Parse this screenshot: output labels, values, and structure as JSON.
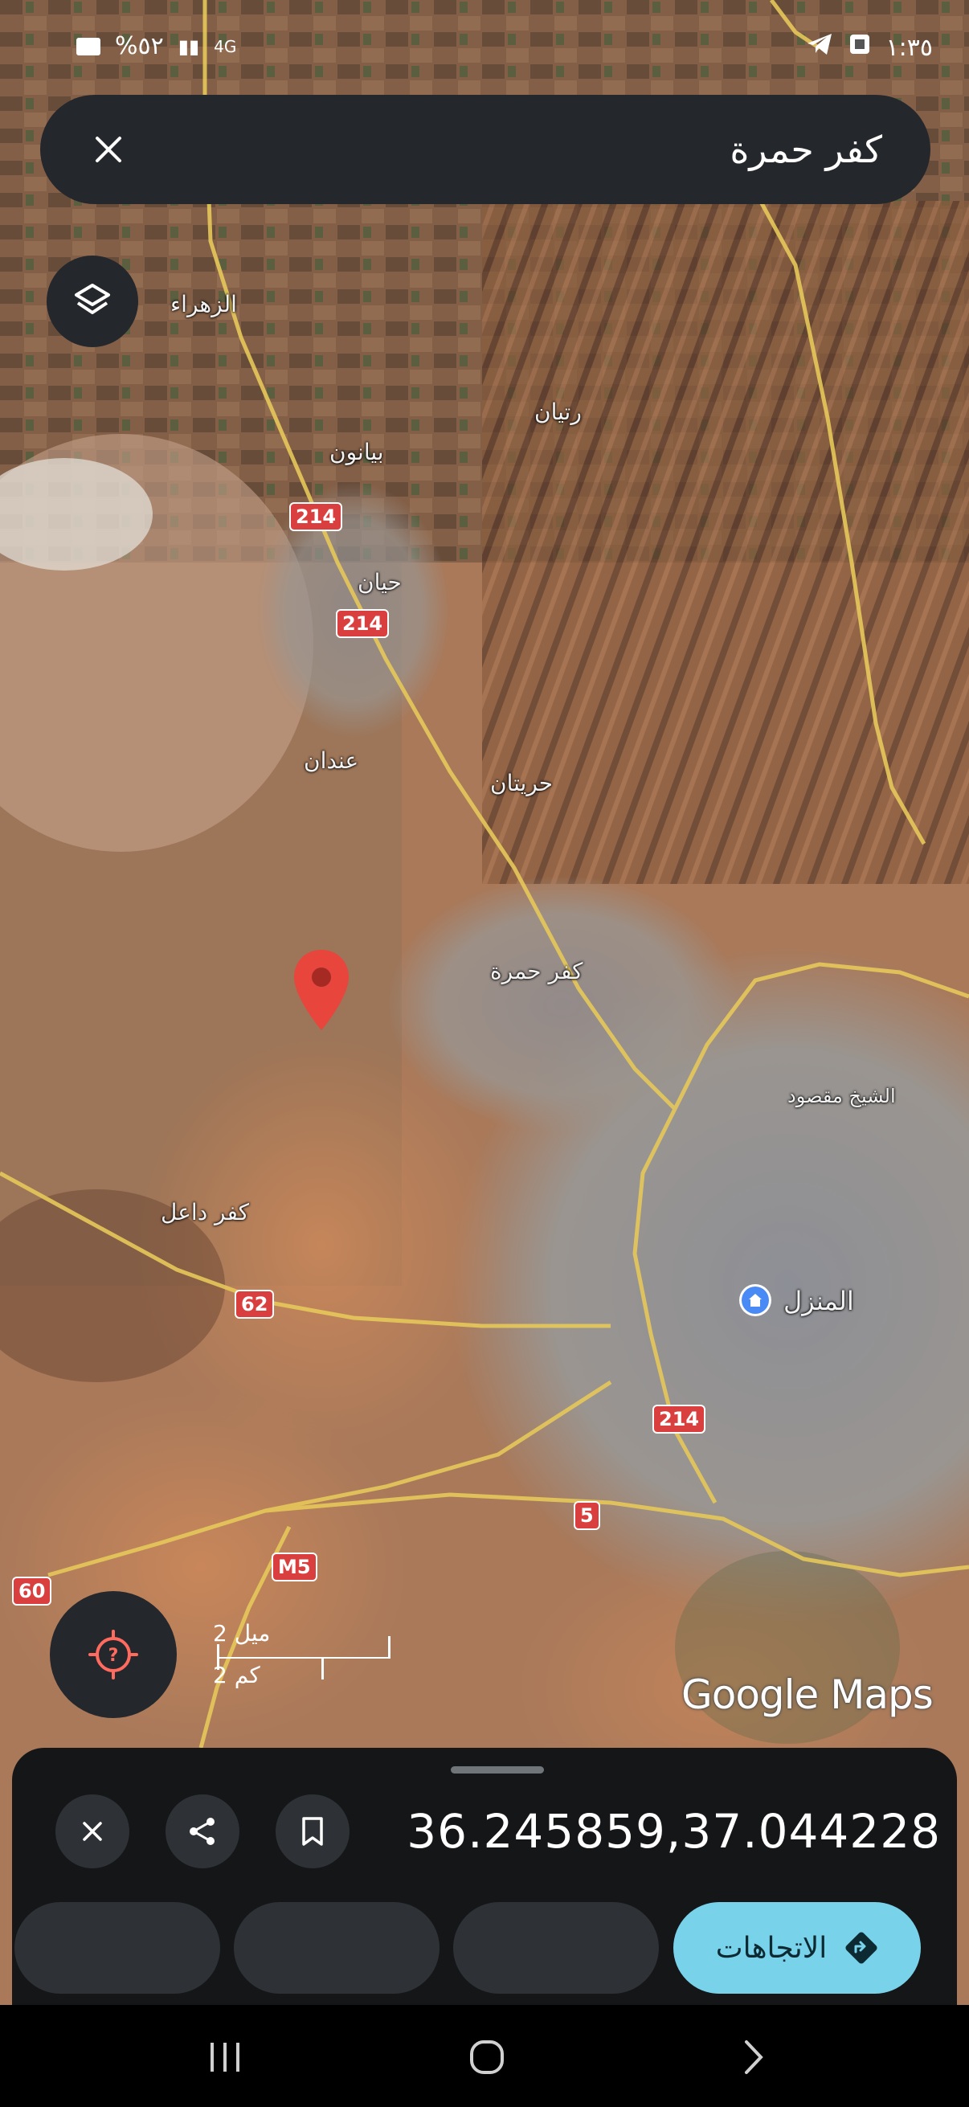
{
  "status_bar": {
    "battery": "%٥٢",
    "signal": "4G",
    "time": "١:٣٥"
  },
  "search": {
    "query": "كفر حمرة"
  },
  "map": {
    "roads": [
      "214",
      "214",
      "214",
      "62",
      "5",
      "M5",
      "60"
    ],
    "places": [
      {
        "id": "zahraa",
        "name": "الزهراء"
      },
      {
        "id": "bayanoun",
        "name": "بيانون"
      },
      {
        "id": "rityan",
        "name": "رتيان"
      },
      {
        "id": "hayan",
        "name": "حيان"
      },
      {
        "id": "anadan",
        "name": "عندان"
      },
      {
        "id": "huraytan",
        "name": "حريتان"
      },
      {
        "id": "kafr_hamra",
        "name": "كفر حمرة"
      },
      {
        "id": "kafr_dael",
        "name": "كفر داعل"
      },
      {
        "id": "sheikh_maqsoud",
        "name": "الشيخ مقصود"
      },
      {
        "id": "home",
        "name": "المنزل"
      }
    ],
    "scale": {
      "imperial": "2 ميل",
      "metric": "2 كم"
    },
    "watermark": "Google Maps"
  },
  "sheet": {
    "coordinates": "36.245859,37.044228",
    "directions_label": "الاتجاهات"
  },
  "colors": {
    "accent": "#78d2ea",
    "pin": "#e8453c",
    "home": "#4a8af4"
  }
}
